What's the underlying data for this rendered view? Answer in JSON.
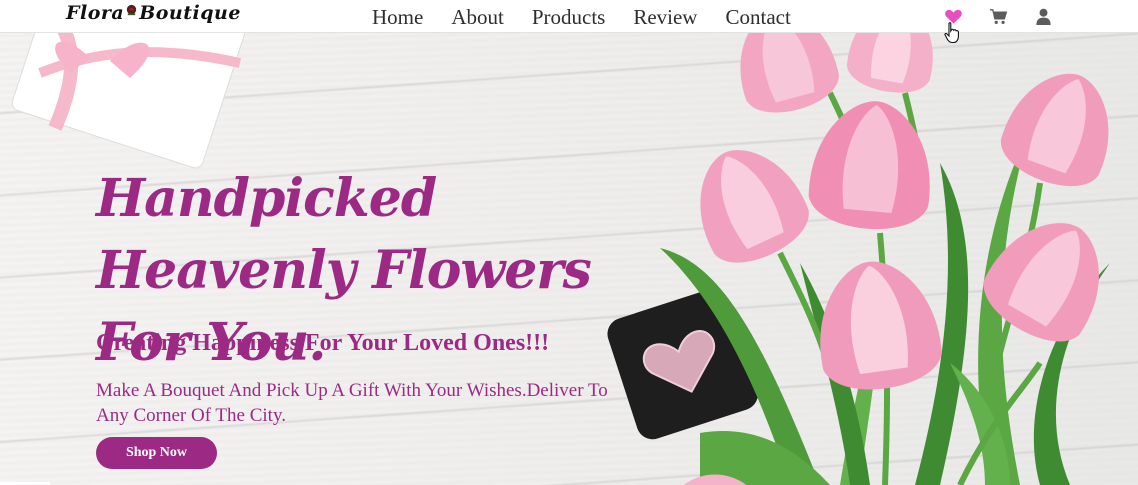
{
  "brand": {
    "logo_text_left": "Flora",
    "logo_text_right": "Boutique"
  },
  "nav": {
    "items": [
      "Home",
      "About",
      "Products",
      "Review",
      "Contact"
    ]
  },
  "header_icons": [
    {
      "icon": "heart-icon",
      "color": "#e84ec0"
    },
    {
      "icon": "cart-icon",
      "color": "#5c5c5c"
    },
    {
      "icon": "user-icon",
      "color": "#5c5c5c"
    }
  ],
  "hero": {
    "heading": "Handpicked Heavenly Flowers For You.",
    "subheading": "Creating Happiness For Your Loved Ones!!!",
    "text": "Make A Bouquet And Pick Up A Gift With Your Wishes.Deliver To Any Corner Of The City.",
    "button": "Shop Now"
  },
  "colors": {
    "accent": "#9c2a85",
    "heart": "#e84ec0",
    "tulip_pink": "#f2a6c2",
    "leaf_green": "#4f9a3b"
  }
}
